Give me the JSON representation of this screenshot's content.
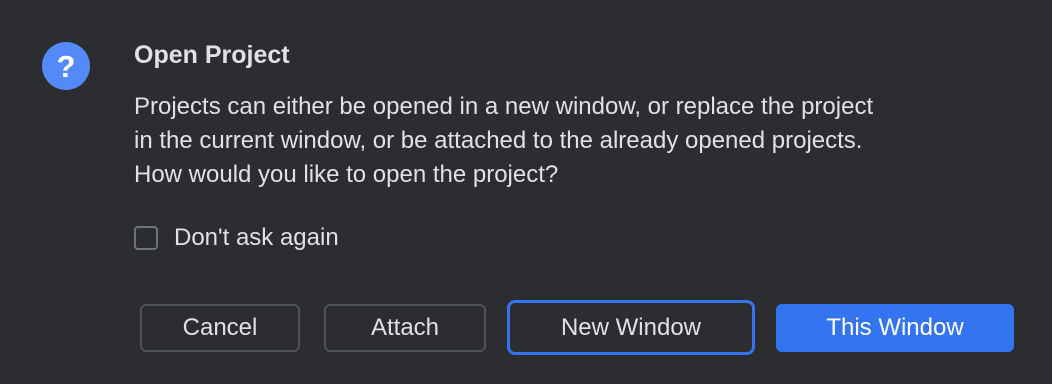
{
  "dialog": {
    "title": "Open Project",
    "message_lines": [
      "Projects can either be opened in a new window, or replace the project",
      "in the current window, or be attached to the already opened projects.",
      "How would you like to open the project?"
    ],
    "icon": "question-icon",
    "icon_glyph": "?",
    "checkbox": {
      "label": "Don't ask again",
      "checked": false
    },
    "buttons": {
      "cancel": "Cancel",
      "attach": "Attach",
      "new_window": "New Window",
      "this_window": "This Window"
    },
    "colors": {
      "background": "#2b2d30",
      "accent": "#3574f0",
      "icon": "#548af7",
      "text": "#dfe1e5"
    }
  }
}
